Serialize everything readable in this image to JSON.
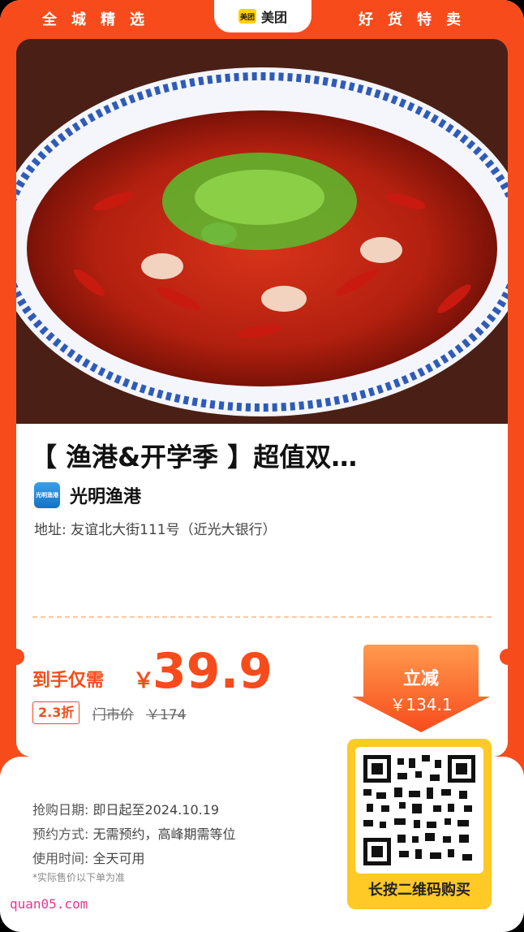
{
  "header": {
    "left_text": "全城精选",
    "right_text": "好货特卖",
    "brand_logo": "美团",
    "brand_name": "美团"
  },
  "deal": {
    "title": "【 渔港&开学季 】超值双…",
    "shop_logo_text": "光明渔港",
    "shop_name": "光明渔港",
    "address": "地址: 友谊北大街111号（近光大银行）"
  },
  "price": {
    "label": "到手仅需",
    "currency": "￥",
    "value": "39.9",
    "discount": "2.3折",
    "original_label": "门市价",
    "original_value": "￥174"
  },
  "badge": {
    "title": "立减",
    "amount": "￥134.1"
  },
  "qr": {
    "caption": "长按二维码购买"
  },
  "info": {
    "rows": [
      {
        "key": "抢购日期:",
        "value": "即日起至2024.10.19"
      },
      {
        "key": "预约方式:",
        "value": "无需预约，高峰期需等位"
      },
      {
        "key": "使用时间:",
        "value": "全天可用"
      }
    ],
    "note": "*实际售价以下单为准"
  },
  "watermark": "quan05.com",
  "colors": {
    "accent": "#f84b1c",
    "qr_frame": "#ffc926"
  }
}
